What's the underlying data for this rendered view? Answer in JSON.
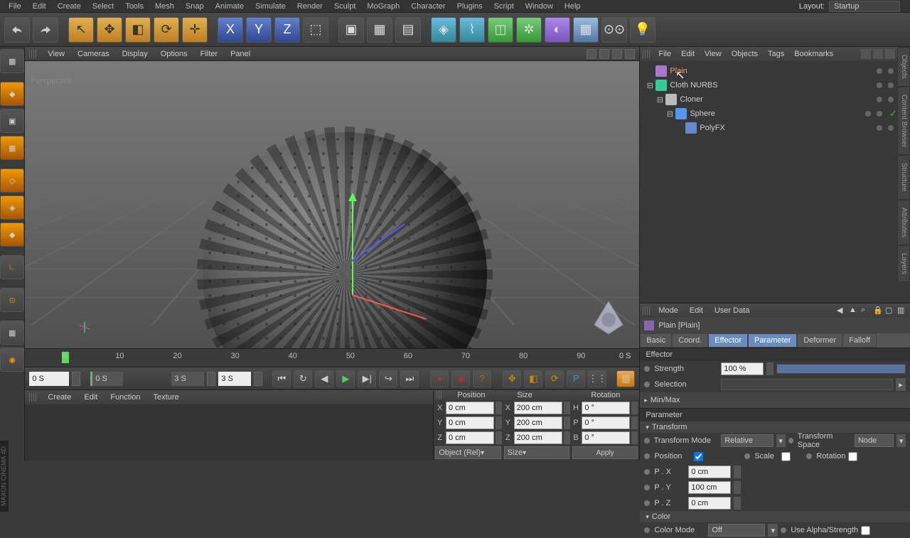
{
  "layout_label": "Layout:",
  "layout_value": "Startup",
  "menubar": [
    "File",
    "Edit",
    "Create",
    "Select",
    "Tools",
    "Mesh",
    "Snap",
    "Animate",
    "Simulate",
    "Render",
    "Sculpt",
    "MoGraph",
    "Character",
    "Plugins",
    "Script",
    "Window",
    "Help"
  ],
  "viewport_menu": [
    "View",
    "Cameras",
    "Display",
    "Options",
    "Filter",
    "Panel"
  ],
  "viewport_label": "Perspective",
  "timeline": {
    "ticks": [
      "0",
      "10",
      "20",
      "30",
      "40",
      "50",
      "60",
      "70",
      "80",
      "90"
    ],
    "end_label": "0 S",
    "cur_frame": "0 S",
    "range_start": "0 S",
    "range_end_in": "3 S",
    "range_end_out": "3 S"
  },
  "material_menu": [
    "Create",
    "Edit",
    "Function",
    "Texture"
  ],
  "coord": {
    "headers": [
      "Position",
      "Size",
      "Rotation"
    ],
    "rows": [
      {
        "axis": "X",
        "pos": "0 cm",
        "size": "200 cm",
        "rot_axis": "H",
        "rot": "0 °"
      },
      {
        "axis": "Y",
        "pos": "0 cm",
        "size": "200 cm",
        "rot_axis": "P",
        "rot": "0 °"
      },
      {
        "axis": "Z",
        "pos": "0 cm",
        "size": "200 cm",
        "rot_axis": "B",
        "rot": "0 °"
      }
    ],
    "foot": [
      "Object (Rel)",
      "Size",
      "Apply"
    ]
  },
  "om_menu": [
    "File",
    "Edit",
    "View",
    "Objects",
    "Tags",
    "Bookmarks"
  ],
  "hierarchy": [
    {
      "indent": 0,
      "exp": "",
      "icon": "#a7c",
      "name": "Plain",
      "sel": true,
      "tag": false
    },
    {
      "indent": 0,
      "exp": "⊟",
      "icon": "#3c9",
      "name": "Cloth NURBS",
      "sel": false,
      "tag": false
    },
    {
      "indent": 1,
      "exp": "⊟",
      "icon": "#bbb",
      "name": "Cloner",
      "sel": false,
      "tag": false
    },
    {
      "indent": 2,
      "exp": "⊟",
      "icon": "#59e",
      "name": "Sphere",
      "sel": false,
      "tag": true
    },
    {
      "indent": 3,
      "exp": "",
      "icon": "#68c",
      "name": "PolyFX",
      "sel": false,
      "tag": false
    }
  ],
  "attr_menu": [
    "Mode",
    "Edit",
    "User Data"
  ],
  "attr_title": "Plain [Plain]",
  "attr_tabs": [
    "Basic",
    "Coord.",
    "Effector",
    "Parameter",
    "Deformer",
    "Falloff"
  ],
  "attr_active_tabs": [
    2,
    3
  ],
  "effector": {
    "header": "Effector",
    "strength_label": "Strength",
    "strength_value": "100 %",
    "selection_label": "Selection",
    "minmax_label": "Min/Max"
  },
  "parameter": {
    "header": "Parameter",
    "transform_header": "Transform",
    "tmode_label": "Transform Mode",
    "tmode_value": "Relative",
    "tspace_label": "Transform Space",
    "tspace_value": "Node",
    "position_label": "Position",
    "scale_label": "Scale",
    "rotation_label": "Rotation",
    "px_label": "P . X",
    "px_value": "0 cm",
    "py_label": "P . Y",
    "py_value": "100 cm",
    "pz_label": "P . Z",
    "pz_value": "0 cm",
    "color_header": "Color",
    "cmode_label": "Color Mode",
    "cmode_value": "Off",
    "alpha_label": "Use Alpha/Strength"
  },
  "brand": "MAXON CINEMA 4D",
  "side_tabs": [
    "Objects",
    "Content Browser",
    "Structure",
    "Attributes",
    "Layers"
  ]
}
